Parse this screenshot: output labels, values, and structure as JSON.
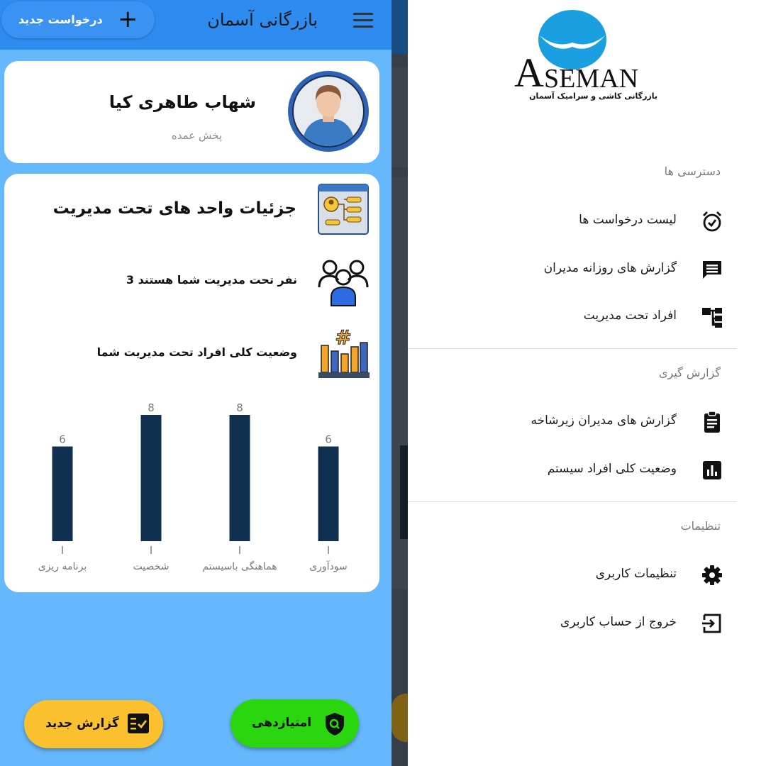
{
  "app_bar": {
    "title": "بازرگانی آسمان",
    "new_request_label": "درخواست جدید"
  },
  "profile": {
    "name": "شهاب طاهری کیا",
    "role": "پخش عمده"
  },
  "details": {
    "title": "جزئیات واحد های تحت مدیریت",
    "team_count_text": "3 نفر تحت مدیریت شما هستند",
    "status_text": "وضعیت کلی افراد تحت مدیریت شما"
  },
  "chart_data": {
    "type": "bar",
    "categories": [
      "برنامه ریزی",
      "شخصیت",
      "هماهنگی باسیستم",
      "سودآوری"
    ],
    "values": [
      6,
      8,
      8,
      6
    ],
    "ylim": [
      0,
      8
    ],
    "grid": false,
    "bar_color": "#10304f"
  },
  "fabs": {
    "new_report_label": "گزارش جدید",
    "rating_label": "امتیازدهی"
  },
  "drawer": {
    "logo_text": "SEMAN",
    "logo_initial": "A",
    "logo_subtitle": "بازرگانی کاشی و سرامیک آسمان",
    "sections": [
      {
        "title": "دسترسی ها",
        "items": [
          {
            "label": "لیست درخواست ها",
            "icon": "alarm-check-icon"
          },
          {
            "label": "گزارش های روزانه مدیران",
            "icon": "message-icon"
          },
          {
            "label": "افراد تحت مدیریت",
            "icon": "hierarchy-icon"
          }
        ]
      },
      {
        "title": "گزارش گیری",
        "items": [
          {
            "label": "گزارش های مدیران زیرشاخه",
            "icon": "clipboard-icon"
          },
          {
            "label": "وضعیت کلی افراد سیستم",
            "icon": "bar-chart-icon"
          }
        ]
      },
      {
        "title": "تنظیمات",
        "items": [
          {
            "label": "تنظیمات کاربری",
            "icon": "gear-icon"
          },
          {
            "label": "خروج از حساب کاربری",
            "icon": "logout-icon"
          }
        ]
      }
    ]
  },
  "colors": {
    "app_bar": "#2e8cf0",
    "background": "#66b8fc",
    "fab_report": "#fbc02d",
    "fab_rating": "#2ad60e",
    "logo_blue": "#1aa0e0"
  }
}
